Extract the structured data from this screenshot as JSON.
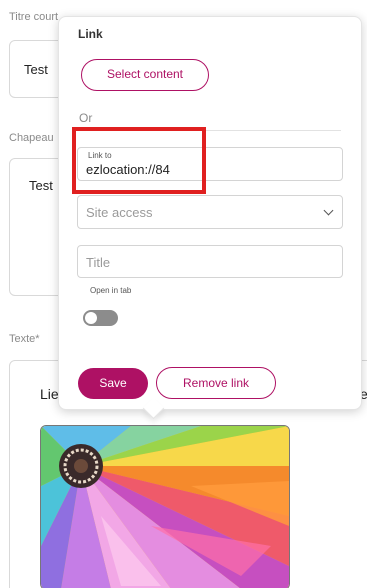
{
  "form": {
    "title_field": {
      "label": "Titre court",
      "value": "Test"
    },
    "chapeau_field": {
      "label": "Chapeau",
      "value": "Test"
    },
    "texte_field": {
      "label": "Texte*",
      "text_start": "Lie",
      "text_end": "e"
    }
  },
  "link_popup": {
    "title": "Link",
    "select_content_label": "Select content",
    "or_label": "Or",
    "link_to": {
      "label": "Link to",
      "value": "ezlocation://84"
    },
    "site_access": {
      "placeholder": "Site access"
    },
    "title_input": {
      "placeholder": "Title"
    },
    "open_in_tab": {
      "label": "Open in tab",
      "enabled": false
    },
    "save_label": "Save",
    "remove_link_label": "Remove link"
  },
  "colors": {
    "accent": "#ae1164",
    "highlight": "#e02020",
    "toggle_off": "#8c8c8c"
  },
  "image": {
    "alt": "colorful abstract image"
  }
}
